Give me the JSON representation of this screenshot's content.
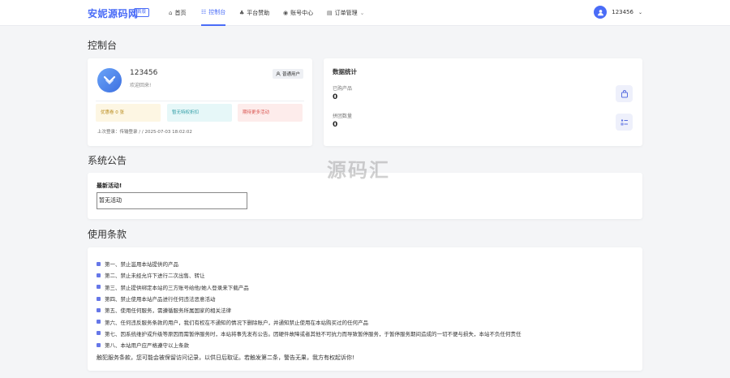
{
  "navbar": {
    "brand": "安妮源码网",
    "brand_tag": "首版",
    "items": [
      {
        "label": "首页",
        "icon": "home-icon"
      },
      {
        "label": "控制台",
        "icon": "dashboard-icon",
        "active": true
      },
      {
        "label": "平台赞助",
        "icon": "sponsor-icon"
      },
      {
        "label": "账号中心",
        "icon": "account-icon"
      },
      {
        "label": "订单管理",
        "icon": "order-icon"
      }
    ],
    "username": "123456"
  },
  "dashboard": {
    "title": "控制台",
    "profile": {
      "username": "123456",
      "welcome": "欢迎回来!",
      "role": "普通用户",
      "tags": [
        "优惠卷 0 张",
        "暂无特权折扣",
        "期待更多活动"
      ],
      "last_login": "上次登录：传输登录 / / 2025-07-03 18:02:02"
    },
    "stats": {
      "title": "数据统计",
      "purchased_label": "已购产品",
      "purchased_value": "0",
      "group_label": "拼团数量",
      "group_value": "0"
    }
  },
  "announcement": {
    "title": "系统公告",
    "heading": "最新活动!",
    "content": "暂无活动"
  },
  "terms": {
    "title": "使用条款",
    "items": [
      "第一、禁止滥用本站提供的产品",
      "第二、禁止未经允许下进行二次出售、转让",
      "第三、禁止提供绑定本站的三方账号给他/她人登录来下载产品",
      "第四、禁止使用本站产品进行任何违法恶意活动",
      "第五、使用任何服务，需遵循服务所属国家的相关法律",
      "第六、任何违反服务条款的用户，我们有权在不通知的情况下删除账户，并通知禁止使用在本站购买过的任何产品",
      "第七、因系统维护或升级等原因而需暂停服务时，本站将事先发布公告。因硬件故障或者其他不可抗力而导致暂停服务，于暂停服务期间造成的一切不便与损失，本站不负任何责任",
      "第八、本站用户应严格遵守以上条款"
    ],
    "footer": "触犯服务条款，您可能会被保留访问记录，以供日后取证。若触发第二条，警告无果，我方有权起诉你!"
  },
  "watermark": "源码汇",
  "colors": {
    "accent": "#4a6cf7",
    "background": "#f4f5f7"
  }
}
